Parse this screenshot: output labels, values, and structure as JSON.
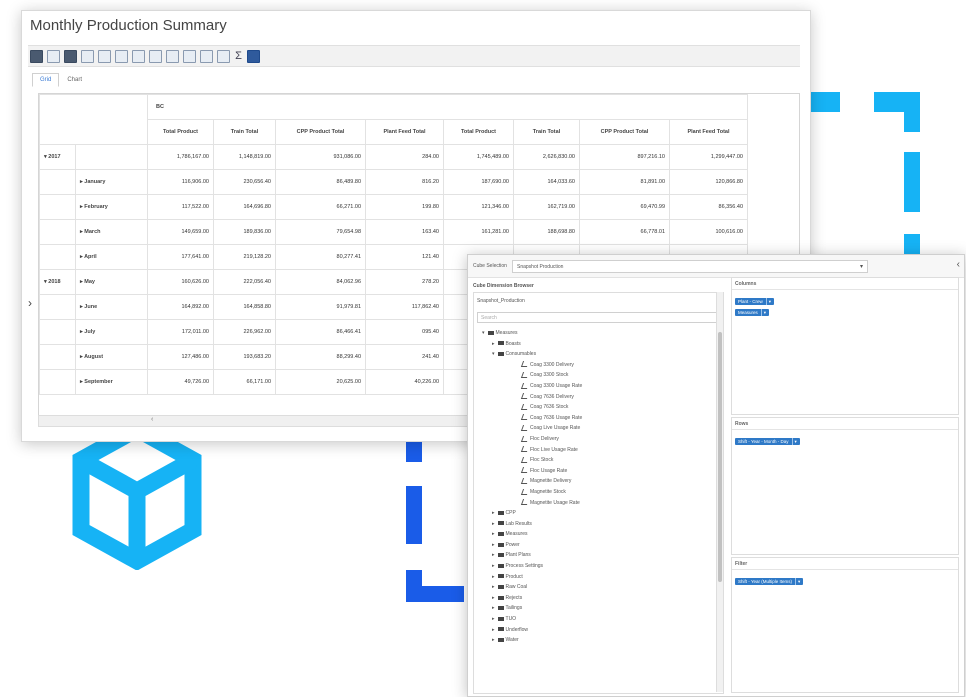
{
  "colors": {
    "accent_dark": "#1a5ce8",
    "accent_mid": "#1d8bf0",
    "accent_light": "#16b3f5",
    "cube": "#16b3f5",
    "chip": "#2e79c7"
  },
  "summary": {
    "title": "Monthly Production Summary",
    "toolbar_icons": [
      "export-excel-icon",
      "open-folder-icon",
      "save-icon",
      "grid-icon",
      "print-icon",
      "table-icon",
      "chart-icon",
      "copy-icon",
      "paste-icon",
      "sort-icon",
      "filter-icon",
      "expand-icon",
      "sum-icon",
      "settings-icon"
    ],
    "tabs": [
      {
        "label": "Grid",
        "active": true
      },
      {
        "label": "Chart",
        "active": false
      }
    ],
    "group_header": "BC",
    "columns": [
      "Total Product",
      "Train Total",
      "CPP Product Total",
      "Plant Feed Total",
      "Total Product",
      "Train Total",
      "CPP Product Total",
      "Plant Feed Total"
    ],
    "rows": [
      {
        "year": "▾ 2017",
        "month": "",
        "values": [
          "1,786,167.00",
          "1,148,819.00",
          "931,086.00",
          "284.00",
          "1,745,489.00",
          "2,626,830.00",
          "897,216.10",
          "1,299,447.00"
        ]
      },
      {
        "year": "",
        "month": "▸ January",
        "values": [
          "116,906.00",
          "230,656.40",
          "86,489.80",
          "816.20",
          "187,690.00",
          "164,033.60",
          "81,891.00",
          "120,866.80"
        ]
      },
      {
        "year": "",
        "month": "▸ February",
        "values": [
          "117,522.00",
          "164,696.80",
          "66,271.00",
          "199.80",
          "121,346.00",
          "162,719.00",
          "69,470.99",
          "86,356.40"
        ]
      },
      {
        "year": "",
        "month": "▸ March",
        "values": [
          "149,659.00",
          "189,836.00",
          "79,654.98",
          "163.40",
          "161,281.00",
          "188,698.80",
          "66,778.01",
          "100,616.00"
        ]
      },
      {
        "year": "",
        "month": "▸ April",
        "values": [
          "177,641.00",
          "219,128.20",
          "80,277.41",
          "121.40",
          "",
          "",
          "",
          ""
        ]
      },
      {
        "year": "▾ 2018",
        "month": "▸ May",
        "values": [
          "160,626.00",
          "222,056.40",
          "84,062.96",
          "278.20",
          "",
          "",
          "",
          ""
        ]
      },
      {
        "year": "",
        "month": "▸ June",
        "values": [
          "164,892.00",
          "164,858.80",
          "91,979.81",
          "117,862.40",
          "",
          "",
          "",
          ""
        ]
      },
      {
        "year": "",
        "month": "▸ July",
        "values": [
          "172,011.00",
          "226,962.00",
          "86,466.41",
          "095.40",
          "",
          "",
          "",
          ""
        ]
      },
      {
        "year": "",
        "month": "▸ August",
        "values": [
          "127,486.00",
          "193,683.20",
          "88,299.40",
          "241.40",
          "",
          "",
          "",
          ""
        ]
      },
      {
        "year": "",
        "month": "▸ September",
        "values": [
          "49,726.00",
          "66,171.00",
          "20,625.00",
          "40,226.00",
          "",
          "",
          "",
          ""
        ]
      }
    ]
  },
  "cube": {
    "selector_label": "Cube Selection",
    "selected_cube": "Snapshot Production",
    "browser_title": "Cube Dimension Browser",
    "cube_name": "Snapshot_Production",
    "search_placeholder": "Search",
    "tree": [
      {
        "label": "Measures",
        "level": 1,
        "kind": "folder",
        "toggle": "▾"
      },
      {
        "label": "Boasts",
        "level": 2,
        "kind": "folder",
        "toggle": "▸"
      },
      {
        "label": "Consumables",
        "level": 2,
        "kind": "folder",
        "toggle": "▾"
      },
      {
        "label": "Coag 3300 Delivery",
        "level": 3,
        "kind": "measure"
      },
      {
        "label": "Coag 3300 Stock",
        "level": 3,
        "kind": "measure"
      },
      {
        "label": "Coag 3300 Usage Rate",
        "level": 3,
        "kind": "measure"
      },
      {
        "label": "Coag 7636 Delivery",
        "level": 3,
        "kind": "measure"
      },
      {
        "label": "Coag 7636 Stock",
        "level": 3,
        "kind": "measure"
      },
      {
        "label": "Coag 7636 Usage Rate",
        "level": 3,
        "kind": "measure"
      },
      {
        "label": "Coag Live Usage Rate",
        "level": 3,
        "kind": "measure"
      },
      {
        "label": "Floc Delivery",
        "level": 3,
        "kind": "measure"
      },
      {
        "label": "Floc Live Usage Rate",
        "level": 3,
        "kind": "measure"
      },
      {
        "label": "Floc Stock",
        "level": 3,
        "kind": "measure"
      },
      {
        "label": "Floc Usage Rate",
        "level": 3,
        "kind": "measure"
      },
      {
        "label": "Magnetite Delivery",
        "level": 3,
        "kind": "measure"
      },
      {
        "label": "Magnetite Stock",
        "level": 3,
        "kind": "measure"
      },
      {
        "label": "Magnetite Usage Rate",
        "level": 3,
        "kind": "measure"
      },
      {
        "label": "CPP",
        "level": 2,
        "kind": "folder",
        "toggle": "▸"
      },
      {
        "label": "Lab Results",
        "level": 2,
        "kind": "folder",
        "toggle": "▸"
      },
      {
        "label": "Measures",
        "level": 2,
        "kind": "folder",
        "toggle": "▸"
      },
      {
        "label": "Power",
        "level": 2,
        "kind": "folder",
        "toggle": "▸"
      },
      {
        "label": "Plant Plans",
        "level": 2,
        "kind": "folder",
        "toggle": "▸"
      },
      {
        "label": "Process Settings",
        "level": 2,
        "kind": "folder",
        "toggle": "▸"
      },
      {
        "label": "Product",
        "level": 2,
        "kind": "folder",
        "toggle": "▸"
      },
      {
        "label": "Raw Coal",
        "level": 2,
        "kind": "folder",
        "toggle": "▸"
      },
      {
        "label": "Rejects",
        "level": 2,
        "kind": "folder",
        "toggle": "▸"
      },
      {
        "label": "Tailings",
        "level": 2,
        "kind": "folder",
        "toggle": "▸"
      },
      {
        "label": "TUO",
        "level": 2,
        "kind": "folder",
        "toggle": "▸"
      },
      {
        "label": "Underflow",
        "level": 2,
        "kind": "folder",
        "toggle": "▸"
      },
      {
        "label": "Water",
        "level": 2,
        "kind": "folder",
        "toggle": "▸"
      }
    ],
    "columns_title": "Columns",
    "column_chips": [
      "Plant - Crew",
      "Measures"
    ],
    "rows_title": "Rows",
    "row_chips": [
      "Shift - Year - Month - Day"
    ],
    "filter_title": "Filter",
    "filter_chips": [
      "Shift - Year (Multiple Items)"
    ]
  }
}
